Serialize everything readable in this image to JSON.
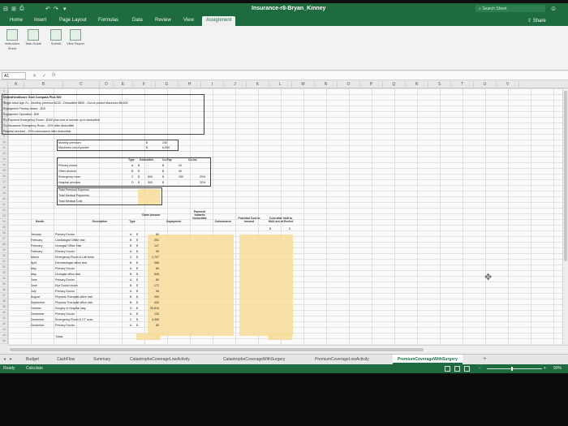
{
  "titlebar": {
    "quick_access": [
      "⊟",
      "⊞",
      "⎙",
      "↶",
      "↷",
      "▾"
    ],
    "document_title": "Insurance-r8-Bryan_Kinney",
    "search_placeholder": "Search Sheet",
    "search_icon": "search-icon",
    "account_icon": "smiley-icon"
  },
  "ribbon_tabs": [
    "Home",
    "Insert",
    "Page Layout",
    "Formulas",
    "Data",
    "Review",
    "View",
    "Assignment"
  ],
  "active_tab": "Assignment",
  "share_label": "Share",
  "ribbon": {
    "buttons": [
      {
        "label": "Instruction Sheet"
      },
      {
        "label": "Task Guide"
      },
      {
        "label": "Submit"
      },
      {
        "label": "View Report"
      }
    ]
  },
  "formula_bar": {
    "name_box": "A1",
    "fx": "fx",
    "cancel": "✕",
    "confirm": "✓",
    "value": ""
  },
  "columns": [
    "A",
    "B",
    "C",
    "D",
    "E",
    "F",
    "G",
    "H",
    "I",
    "J",
    "K",
    "L",
    "M",
    "N",
    "O",
    "P",
    "Q",
    "R",
    "S",
    "T",
    "U",
    "V"
  ],
  "plan_box": {
    "lines": [
      "UnitedHealthcare Gold Compass Plus 500",
      "Single Adult Age 21 - Monthly premium $230 - Deductible $500 - Out-of-pocket Maximum $6,600",
      "Copayment Primary doctor - $20",
      "Copayment Specialist - $40",
      "Co-Payment Emergency Room - $250 plus cost of service up to deductible",
      "Co-Insurance Emergency Room - 20% after deductible",
      "Hospital services - 20% coinsurance after deductible"
    ]
  },
  "premium_box": {
    "rows": [
      {
        "label": "Monthly premium",
        "cur": "$",
        "value": "230"
      },
      {
        "label": "Maximum out-of-pocket",
        "cur": "$",
        "value": "6,600"
      }
    ]
  },
  "type_table": {
    "headers": [
      "Type",
      "Deductible",
      "Co-Pay",
      "Co-ins"
    ],
    "rows": [
      {
        "label": "Primary doctor",
        "type": "A",
        "cur": "$",
        "ded": "-",
        "cpcur": "$",
        "copay": "20",
        "coins": ""
      },
      {
        "label": "Other doctors",
        "type": "B",
        "cur": "$",
        "ded": "-",
        "cpcur": "$",
        "copay": "40",
        "coins": ""
      },
      {
        "label": "Emergency room",
        "type": "C",
        "cur": "$",
        "ded": "500",
        "cpcur": "$",
        "copay": "250",
        "coins": "20%"
      },
      {
        "label": "Hospital services",
        "type": "D",
        "cur": "$",
        "ded": "500",
        "cpcur": "$",
        "copay": "-",
        "coins": "20%"
      }
    ]
  },
  "totals_box": [
    "Total Premium Expense",
    "Total Medical Payments",
    "Total Medical Cost"
  ],
  "claims": {
    "headers": [
      "Month",
      "Description",
      "Type",
      "Claim Amount",
      "Copayment",
      "Payment towards Deductible",
      "Coinsurance",
      "Potential Cost to Insured",
      "Cost after limit to MAX out-of-Pocket"
    ],
    "limit_row": {
      "cur": "$",
      "value": "0"
    },
    "rows": [
      {
        "month": "January",
        "desc": "Primary Doctor",
        "type": "A",
        "amount": "80"
      },
      {
        "month": "February",
        "desc": "Cardiologist Office visit",
        "type": "B",
        "amount": "251"
      },
      {
        "month": "February",
        "desc": "Urologist Office Visit",
        "type": "B",
        "amount": "147"
      },
      {
        "month": "February",
        "desc": "Primary Doctor",
        "type": "A",
        "amount": "95"
      },
      {
        "month": "March",
        "desc": "Emergency Room & Lab tests",
        "type": "C",
        "amount": "1,707"
      },
      {
        "month": "April",
        "desc": "Dermatologist office visit",
        "type": "B",
        "amount": "366"
      },
      {
        "month": "May",
        "desc": "Primary Doctor",
        "type": "A",
        "amount": "80"
      },
      {
        "month": "May",
        "desc": "Urologist office visit",
        "type": "B",
        "amount": "545"
      },
      {
        "month": "June",
        "desc": "Primary Doctor",
        "type": "A",
        "amount": "80"
      },
      {
        "month": "June",
        "desc": "Eye Doctor exam",
        "type": "B",
        "amount": "171"
      },
      {
        "month": "July",
        "desc": "Primary Doctor",
        "type": "A",
        "amount": "95"
      },
      {
        "month": "August",
        "desc": "Physical Therapist office visit",
        "type": "B",
        "amount": "250"
      },
      {
        "month": "September",
        "desc": "Physical Therapist office visit",
        "type": "B",
        "amount": "420"
      },
      {
        "month": "October",
        "desc": "Surgery & Hospital stay",
        "type": "D",
        "amount": "53,816"
      },
      {
        "month": "December",
        "desc": "Primary Doctor",
        "type": "A",
        "amount": "133"
      },
      {
        "month": "December",
        "desc": "Emergency Room & CT scan",
        "type": "C",
        "amount": "4,300"
      },
      {
        "month": "December",
        "desc": "Primary Doctor",
        "type": "A",
        "amount": "80"
      }
    ],
    "totals_label": "Totals"
  },
  "sheet_tabs": [
    "Budget",
    "CashFlow",
    "Summary",
    "CatastropheCoverageLowActivity",
    "CatastropheCoverageWithSurgery",
    "PremiumCoverageLowActivity",
    "PremiumCoverageWithSurgery"
  ],
  "active_sheet": "PremiumCoverageWithSurgery",
  "add_sheet": "+",
  "status": {
    "ready": "Ready",
    "calculate": "Calculate",
    "zoom": "90%"
  },
  "colors": {
    "excel_green": "#1e6b3f",
    "input_yellow": "#f6dc9a"
  }
}
